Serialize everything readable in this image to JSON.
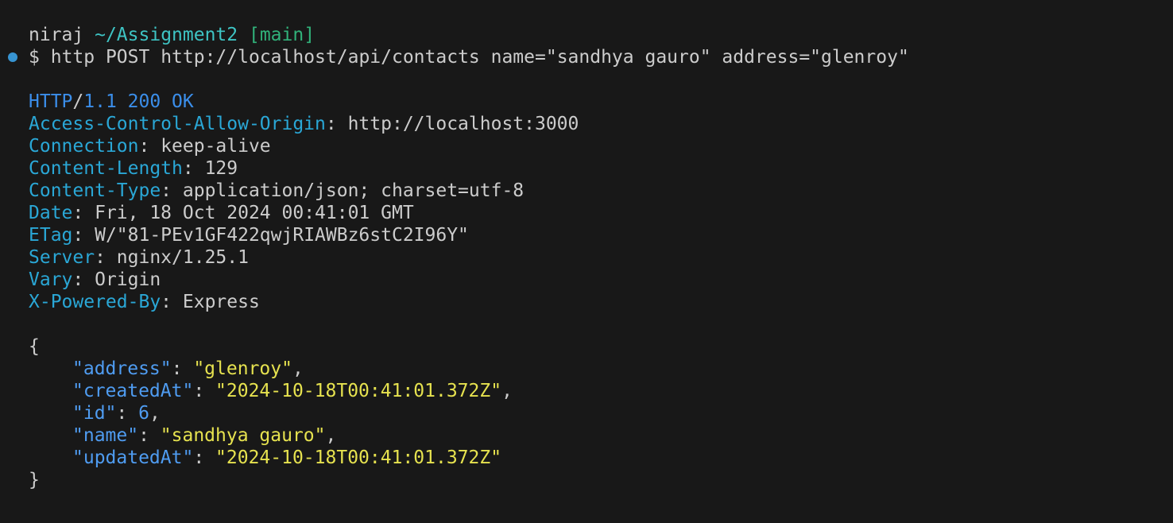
{
  "prompt": {
    "user": "niraj",
    "path": "~/Assignment2",
    "branch": "[main]",
    "symbol": "$",
    "command": "http POST http://localhost/api/contacts name=\"sandhya gauro\" address=\"glenroy\""
  },
  "response": {
    "protocol": "HTTP",
    "version_status": "1.1 200 OK",
    "headers": [
      {
        "key": "Access-Control-Allow-Origin",
        "value": "http://localhost:3000"
      },
      {
        "key": "Connection",
        "value": "keep-alive"
      },
      {
        "key": "Content-Length",
        "value": "129"
      },
      {
        "key": "Content-Type",
        "value": "application/json; charset=utf-8"
      },
      {
        "key": "Date",
        "value": "Fri, 18 Oct 2024 00:41:01 GMT"
      },
      {
        "key": "ETag",
        "value": "W/\"81-PEv1GF422qwjRIAWBz6stC2I96Y\""
      },
      {
        "key": "Server",
        "value": "nginx/1.25.1"
      },
      {
        "key": "Vary",
        "value": "Origin"
      },
      {
        "key": "X-Powered-By",
        "value": "Express"
      }
    ]
  },
  "body": {
    "open_brace": "{",
    "close_brace": "}",
    "fields": [
      {
        "key": "\"address\"",
        "value": "\"glenroy\"",
        "type": "string",
        "comma": ","
      },
      {
        "key": "\"createdAt\"",
        "value": "\"2024-10-18T00:41:01.372Z\"",
        "type": "string",
        "comma": ","
      },
      {
        "key": "\"id\"",
        "value": "6",
        "type": "number",
        "comma": ","
      },
      {
        "key": "\"name\"",
        "value": "\"sandhya gauro\"",
        "type": "string",
        "comma": ","
      },
      {
        "key": "\"updatedAt\"",
        "value": "\"2024-10-18T00:41:01.372Z\"",
        "type": "string",
        "comma": ""
      }
    ]
  },
  "colors": {
    "background": "#181818",
    "text": "#cccccc",
    "path": "#3ec4c4",
    "branch": "#31b27a",
    "header_key": "#2aa7d6",
    "json_key": "#4f9cf1",
    "json_string": "#e6e24f",
    "prompt_dot": "#3794d2"
  }
}
